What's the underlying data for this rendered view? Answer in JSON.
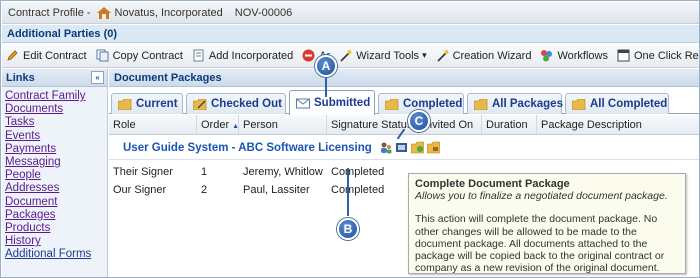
{
  "window": {
    "title": "Contract Profile -",
    "company": "Novatus, Incorporated",
    "contract_id": "NOV-00006"
  },
  "parties": {
    "label": "Additional Parties (0)"
  },
  "toolbar": {
    "items": [
      {
        "label": "Edit Contract",
        "icon": "pencil-icon"
      },
      {
        "label": "Copy Contract",
        "icon": "copy-icon"
      },
      {
        "label": "Add Incorporated",
        "icon": "add-document-icon"
      },
      {
        "label": "Ar",
        "icon": "archive-icon"
      },
      {
        "label": "Wizard Tools",
        "icon": "wand-icon",
        "dropdown": "▾"
      },
      {
        "label": "Creation Wizard",
        "icon": "wand-icon"
      },
      {
        "label": "Workflows",
        "icon": "workflow-icon"
      },
      {
        "label": "One Click Report",
        "icon": "report-icon"
      }
    ]
  },
  "sidebar": {
    "title": "Links",
    "collapse_glyph": "«",
    "items": [
      {
        "label": "Contract Family"
      },
      {
        "label": "Documents"
      },
      {
        "label": "Tasks"
      },
      {
        "label": "Events"
      },
      {
        "label": "Payments"
      },
      {
        "label": "Messaging"
      },
      {
        "label": "People"
      },
      {
        "label": "Addresses"
      },
      {
        "label": "Document Packages"
      },
      {
        "label": "Products"
      },
      {
        "label": "History"
      },
      {
        "label": "Additional Forms"
      }
    ]
  },
  "main": {
    "title": "Document Packages",
    "tabs": [
      {
        "label": "Current"
      },
      {
        "label": "Checked Out"
      },
      {
        "label": "Submitted"
      },
      {
        "label": "Completed"
      },
      {
        "label": "All Packages"
      },
      {
        "label": "All Completed"
      }
    ],
    "active_tab": "Submitted",
    "columns": [
      "Role",
      "Order",
      "Person",
      "Signature Status",
      "Invited On",
      "Duration",
      "Package Description"
    ],
    "sort_indicator": "▲",
    "group": {
      "title": "User Guide System - ABC Software Licensing"
    },
    "rows": [
      {
        "role": "Their Signer",
        "order": "1",
        "person": "Jeremy, Whitlow",
        "status": "Completed"
      },
      {
        "role": "Our Signer",
        "order": "2",
        "person": "Paul, Lassiter",
        "status": "Completed"
      }
    ]
  },
  "tooltip": {
    "title": "Complete Document Package",
    "subtitle": "Allows you to finalize a negotiated document package.",
    "body": "This action will complete the document package. No other changes will be allowed to be made to the document package. All documents attached to the package will be copied back to the original contract or company as a new revision of the original document."
  },
  "callouts": [
    "A",
    "B",
    "C"
  ],
  "colors": {
    "accent": "#1a56b0",
    "link_visited": "#5b1b8c",
    "header_blue": "#0d3a78"
  }
}
